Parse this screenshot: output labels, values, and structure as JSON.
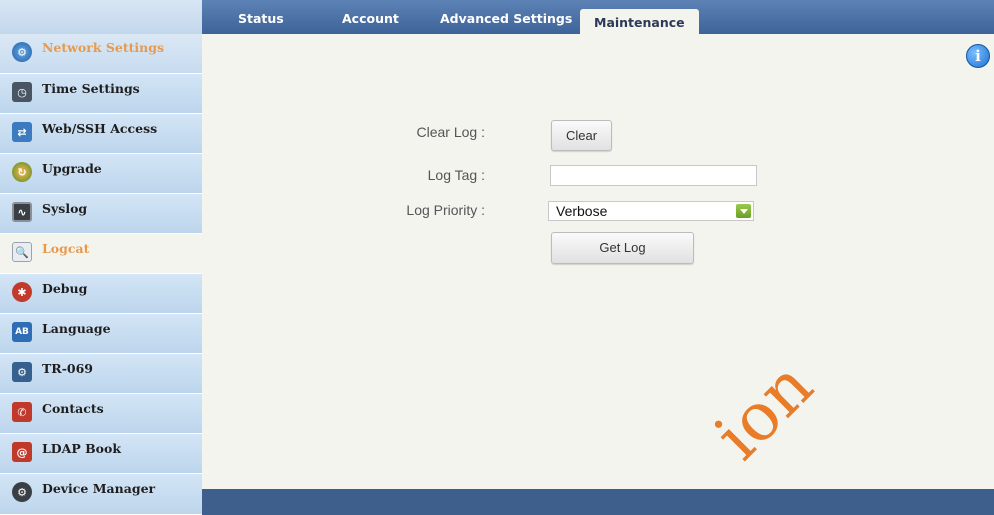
{
  "nav": {
    "tabs": [
      {
        "label": "Status"
      },
      {
        "label": "Account"
      },
      {
        "label": "Advanced Settings"
      },
      {
        "label": "Maintenance",
        "active": true
      }
    ]
  },
  "sidebar": {
    "items": [
      {
        "label": "Network Settings",
        "icon": "network-icon",
        "active": false,
        "highlight": true
      },
      {
        "label": "Time Settings",
        "icon": "time-icon"
      },
      {
        "label": "Web/SSH Access",
        "icon": "web-access-icon"
      },
      {
        "label": "Upgrade",
        "icon": "upgrade-icon"
      },
      {
        "label": "Syslog",
        "icon": "syslog-icon"
      },
      {
        "label": "Logcat",
        "icon": "logcat-icon",
        "active": true
      },
      {
        "label": "Debug",
        "icon": "debug-icon"
      },
      {
        "label": "Language",
        "icon": "language-icon"
      },
      {
        "label": "TR-069",
        "icon": "tr069-icon"
      },
      {
        "label": "Contacts",
        "icon": "contacts-icon"
      },
      {
        "label": "LDAP Book",
        "icon": "ldap-icon"
      },
      {
        "label": "Device Manager",
        "icon": "device-manager-icon"
      }
    ]
  },
  "form": {
    "clear_log_label": "Clear Log :",
    "clear_button": "Clear",
    "log_tag_label": "Log Tag :",
    "log_tag_value": "",
    "log_priority_label": "Log Priority :",
    "log_priority_value": "Verbose",
    "get_log_button": "Get Log"
  },
  "watermark": "ion",
  "colors": {
    "nav_bg": "#4a6fa5",
    "sidebar_bg": "#c8ddf1",
    "content_bg": "#f4f4ef",
    "active_text": "#e79a4d",
    "footer_bg": "#3e5f8c",
    "select_arrow": "#7cb134"
  }
}
